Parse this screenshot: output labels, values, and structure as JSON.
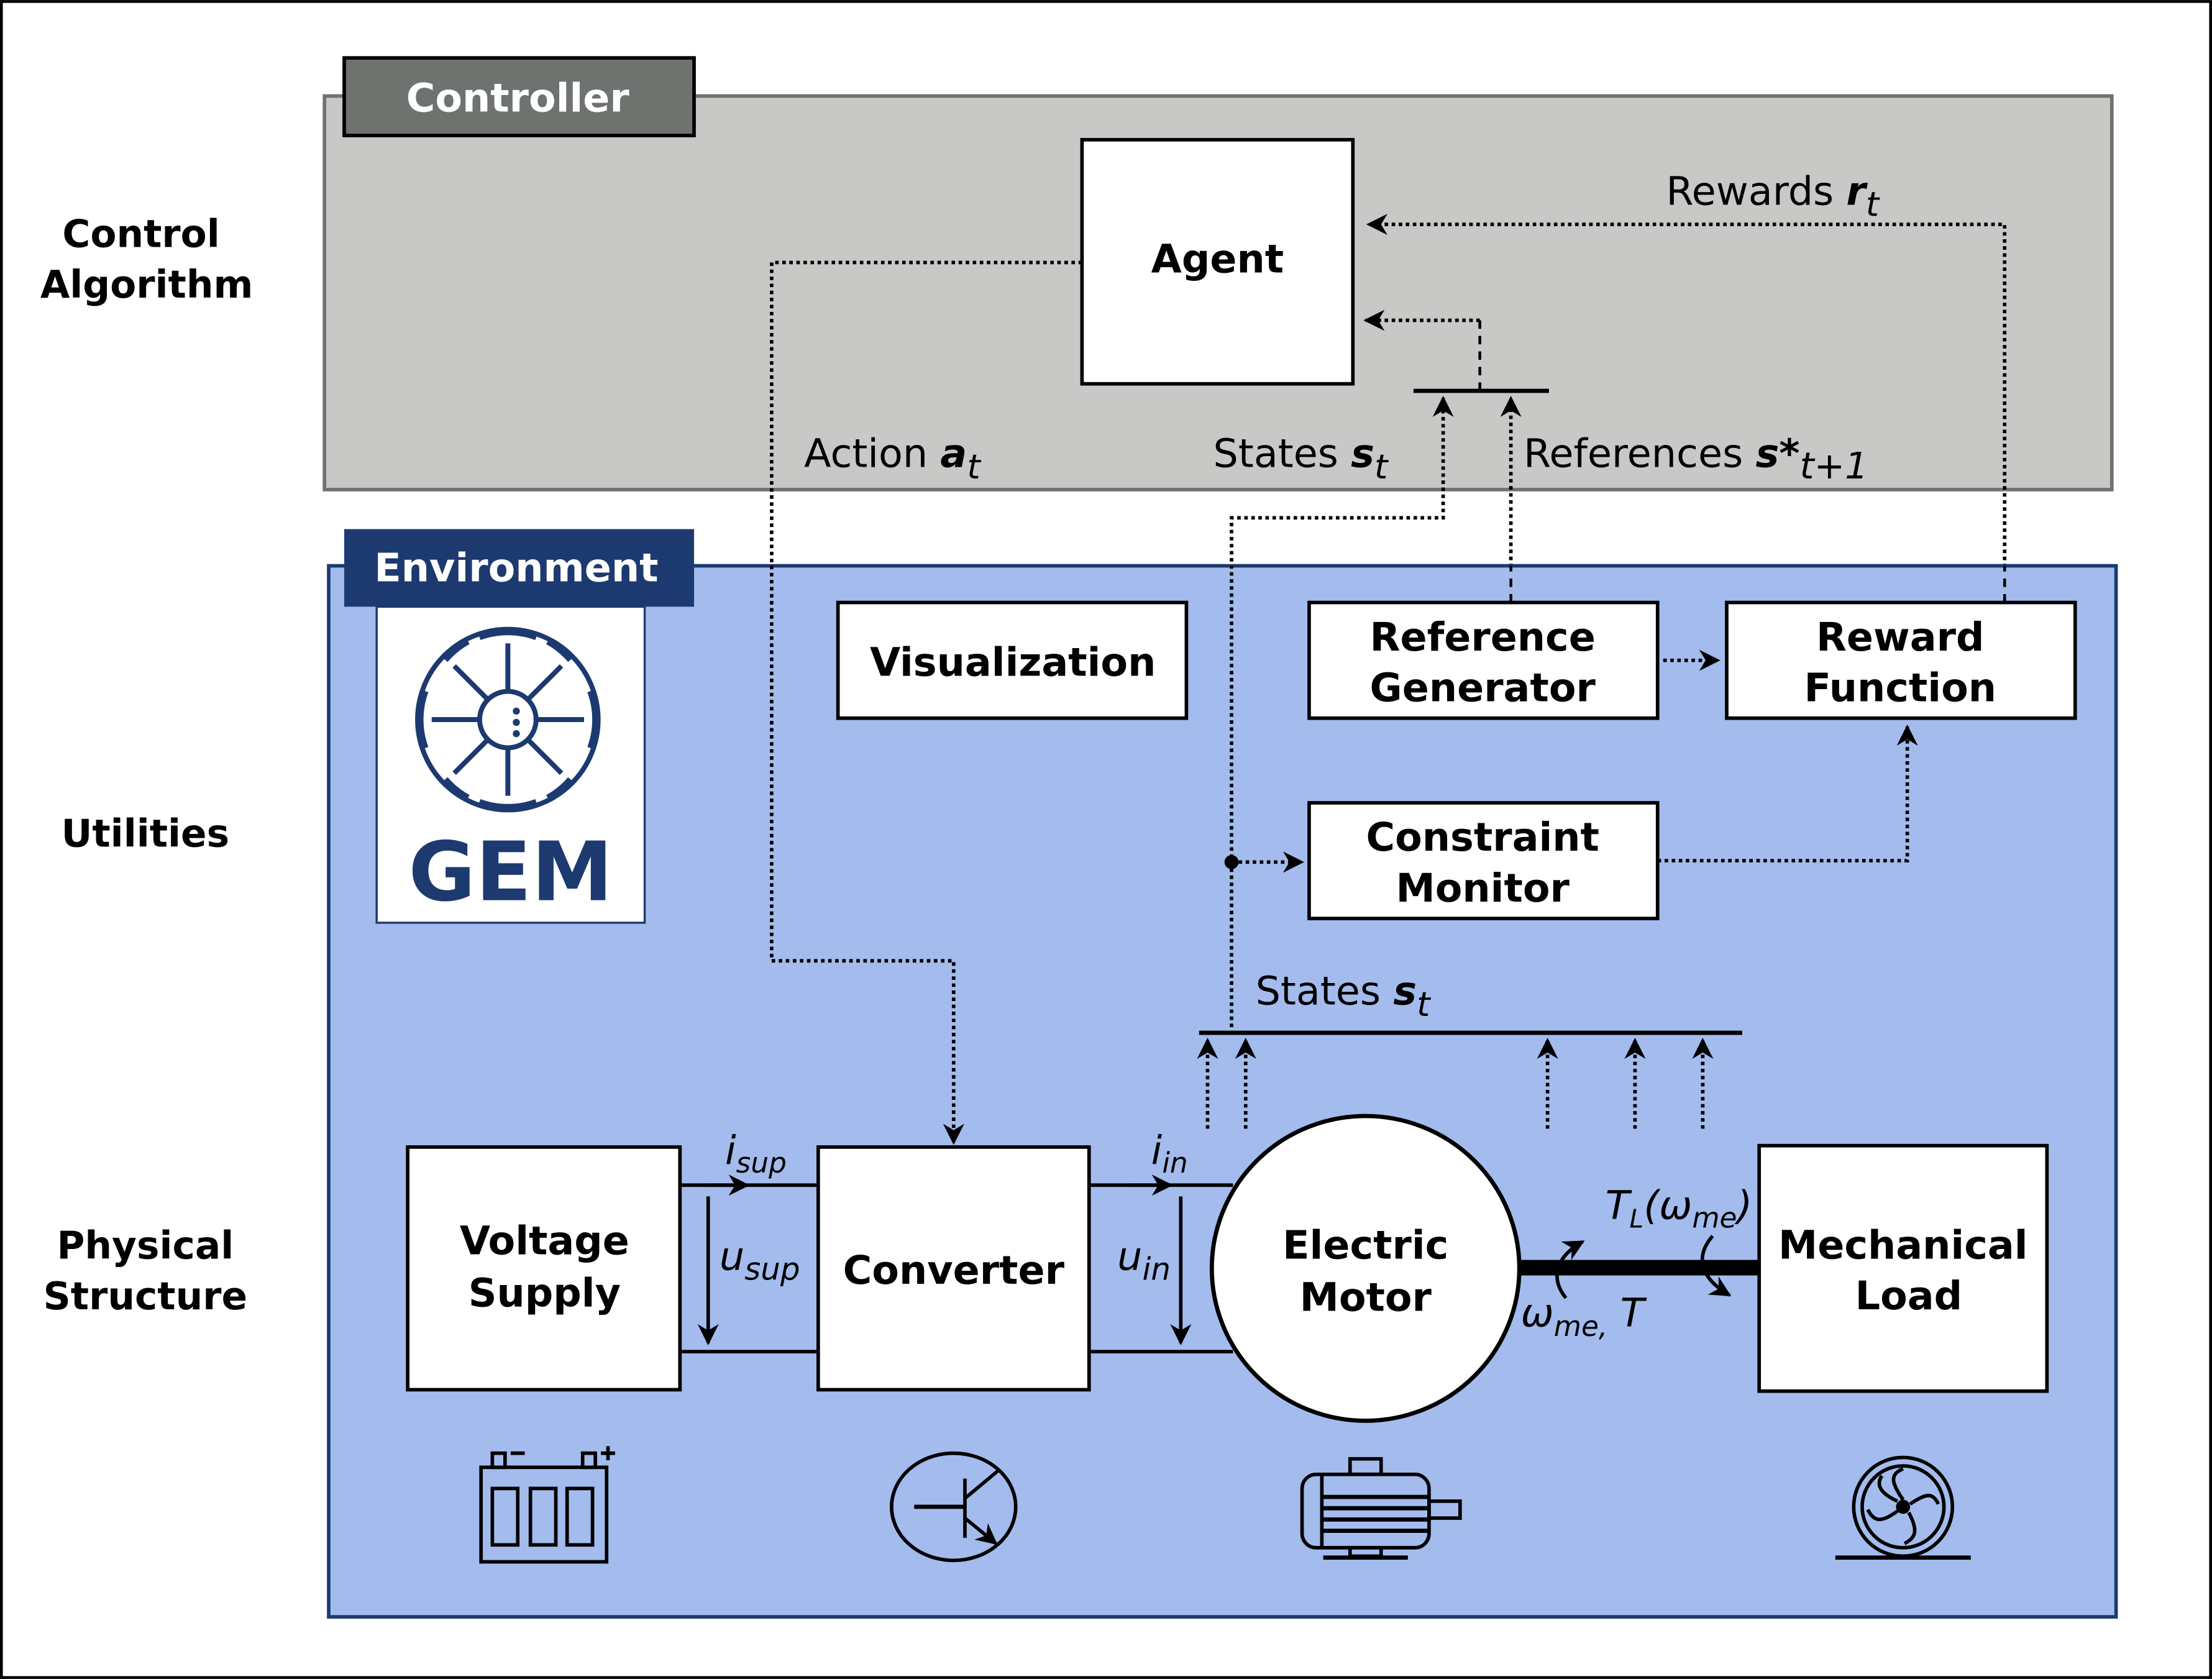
{
  "side_labels": {
    "control_algorithm": [
      "Control",
      "Algorithm"
    ],
    "utilities": "Utilities",
    "physical_structure": [
      "Physical",
      "Structure"
    ]
  },
  "controller": {
    "tag": "Controller",
    "agent": "Agent",
    "signals": {
      "rewards_text": "Rewards ",
      "rewards_sym": "r",
      "rewards_sub": "t",
      "action_text": "Action ",
      "action_sym": "a",
      "action_sub": "t",
      "states_text": "States ",
      "states_sym": "s",
      "states_sub": "t",
      "references_text": "References ",
      "references_sym": "s*",
      "references_sub": "t+1"
    }
  },
  "environment": {
    "tag": "Environment",
    "logo_text": "GEM",
    "utilities": {
      "visualization": "Visualization",
      "reference_generator": [
        "Reference",
        "Generator"
      ],
      "reward_function": [
        "Reward",
        "Function"
      ],
      "constraint_monitor": [
        "Constraint",
        "Monitor"
      ]
    },
    "states_bus": {
      "text": "States ",
      "sym": "s",
      "sub": "t"
    },
    "physical": {
      "voltage_supply": [
        "Voltage",
        "Supply"
      ],
      "converter": "Converter",
      "electric_motor": [
        "Electric",
        "Motor"
      ],
      "mechanical_load": [
        "Mechanical",
        "Load"
      ],
      "i_sup": {
        "sym": "i",
        "sub": "sup"
      },
      "u_sup": {
        "sym": "u",
        "sub": "sup"
      },
      "i_in": {
        "sym": "i",
        "sub": "in"
      },
      "u_in": {
        "sym": "u",
        "sub": "in"
      },
      "load_torque": {
        "sym": "T",
        "sub": "L",
        "rest": "(ω",
        "sub2": "me",
        "close": ")"
      },
      "motor_output": {
        "sym": "ω",
        "sub": "me,",
        "rest": " T"
      }
    },
    "icons": [
      "battery-icon",
      "transistor-icon",
      "motor-icon",
      "fan-icon"
    ]
  },
  "colors": {
    "controller_bg": "#c8c9c6",
    "controller_border": "#6f726f",
    "controller_tag": "#6f736f",
    "environment_bg": "#a3bced",
    "environment_border": "#1c3a70",
    "environment_tag": "#1c3a70"
  }
}
